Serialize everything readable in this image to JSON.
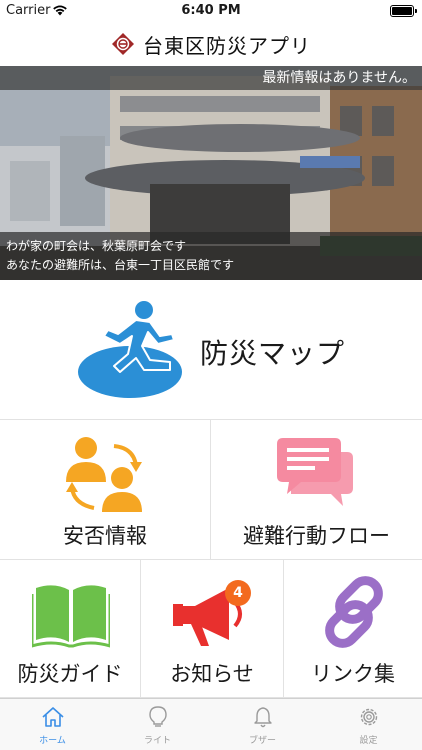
{
  "status_bar": {
    "carrier": "Carrier",
    "time": "6:40 PM"
  },
  "nav": {
    "title": "台東区防災アプリ"
  },
  "hero": {
    "news": "最新情報はありません。",
    "district_line": "わが家の町会は、秋葉原町会です",
    "shelter_line": "あなたの避難所は、台東一丁目区民館です"
  },
  "map_button": {
    "label": "防災マップ"
  },
  "tiles": {
    "safety": {
      "label": "安否情報"
    },
    "evac_flow": {
      "label": "避難行動フロー"
    },
    "guide": {
      "label": "防災ガイド"
    },
    "notices": {
      "label": "お知らせ",
      "badge": "4"
    },
    "links": {
      "label": "リンク集"
    }
  },
  "tabbar": {
    "items": [
      {
        "label": "ホーム",
        "icon": "home-icon",
        "active": true
      },
      {
        "label": "ライト",
        "icon": "lightbulb-icon",
        "active": false
      },
      {
        "label": "ブザー",
        "icon": "bell-icon",
        "active": false
      },
      {
        "label": "設定",
        "icon": "gear-icon",
        "active": false
      }
    ]
  },
  "colors": {
    "accent_blue": "#3a8ee6",
    "map_blue": "#2b8fd6",
    "safety_orange": "#f5a623",
    "evac_pink": "#f58aa0",
    "guide_green": "#6cc04a",
    "notice_red": "#e8302e",
    "badge_orange": "#f36a1e",
    "links_purple": "#9b6fc7"
  }
}
